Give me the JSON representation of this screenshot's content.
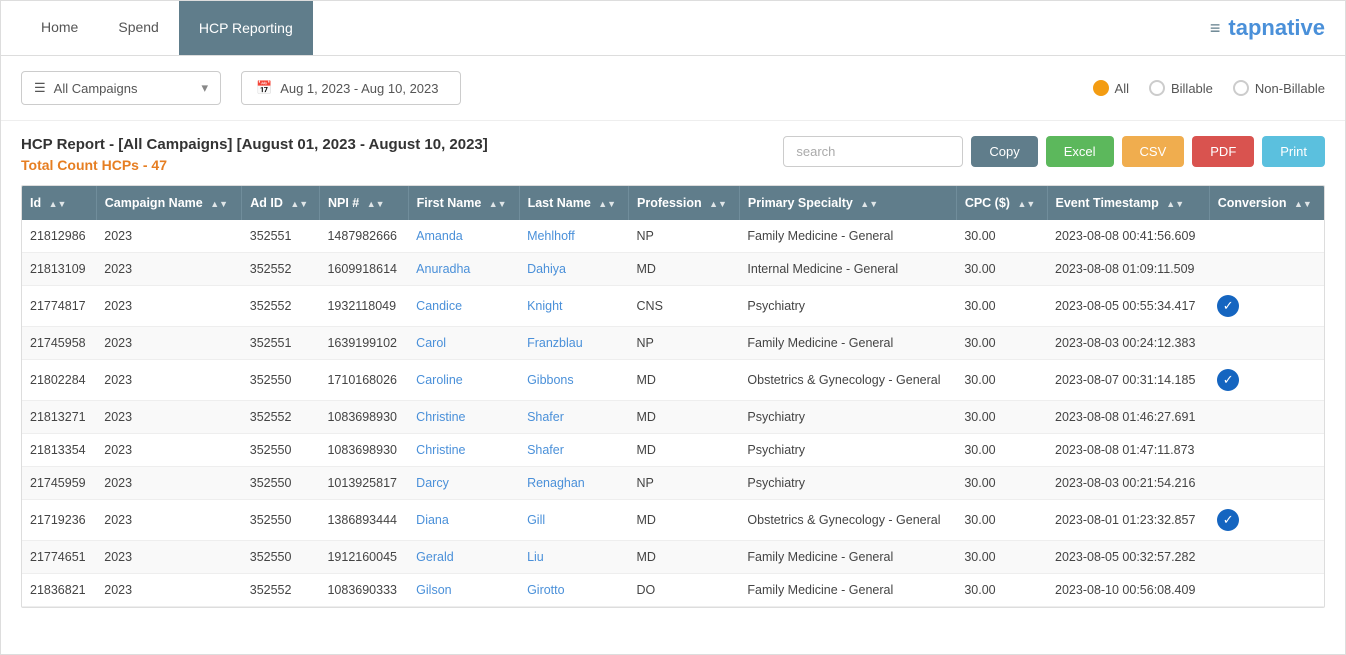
{
  "nav": {
    "tabs": [
      {
        "id": "home",
        "label": "Home",
        "active": false
      },
      {
        "id": "spend",
        "label": "Spend",
        "active": false
      },
      {
        "id": "hcp-reporting",
        "label": "HCP Reporting",
        "active": true
      }
    ],
    "logo": {
      "icon": "≡",
      "text_part1": "tap",
      "text_part2": "native"
    }
  },
  "filters": {
    "campaign_placeholder": "All Campaigns",
    "date_range": "Aug 1, 2023 - Aug 10, 2023",
    "radio_options": [
      {
        "id": "all",
        "label": "All",
        "checked": true
      },
      {
        "id": "billable",
        "label": "Billable",
        "checked": false
      },
      {
        "id": "non-billable",
        "label": "Non-Billable",
        "checked": false
      }
    ]
  },
  "report": {
    "title": "HCP Report - [All Campaigns] [August 01, 2023 - August 10, 2023]",
    "count_label": "Total Count HCPs -",
    "count_value": "47",
    "search_placeholder": "search"
  },
  "toolbar_buttons": {
    "copy": "Copy",
    "excel": "Excel",
    "csv": "CSV",
    "pdf": "PDF",
    "print": "Print"
  },
  "table": {
    "columns": [
      {
        "id": "id",
        "label": "Id",
        "sortable": true
      },
      {
        "id": "campaign_name",
        "label": "Campaign Name",
        "sortable": true
      },
      {
        "id": "ad_id",
        "label": "Ad ID",
        "sortable": true
      },
      {
        "id": "npi",
        "label": "NPI #",
        "sortable": true
      },
      {
        "id": "first_name",
        "label": "First Name",
        "sortable": true
      },
      {
        "id": "last_name",
        "label": "Last Name",
        "sortable": true
      },
      {
        "id": "profession",
        "label": "Profession",
        "sortable": true
      },
      {
        "id": "primary_specialty",
        "label": "Primary Specialty",
        "sortable": true
      },
      {
        "id": "cpc",
        "label": "CPC ($)",
        "sortable": true
      },
      {
        "id": "event_timestamp",
        "label": "Event Timestamp",
        "sortable": true
      },
      {
        "id": "conversion",
        "label": "Conversion",
        "sortable": true
      }
    ],
    "rows": [
      {
        "id": "21812986",
        "campaign_name": "2023",
        "ad_id": "352551",
        "npi": "1487982666",
        "first_name": "Amanda",
        "last_name": "Mehlhoff",
        "profession": "NP",
        "primary_specialty": "Family Medicine - General",
        "cpc": "30.00",
        "event_timestamp": "2023-08-08 00:41:56.609",
        "conversion": false
      },
      {
        "id": "21813109",
        "campaign_name": "2023",
        "ad_id": "352552",
        "npi": "1609918614",
        "first_name": "Anuradha",
        "last_name": "Dahiya",
        "profession": "MD",
        "primary_specialty": "Internal Medicine - General",
        "cpc": "30.00",
        "event_timestamp": "2023-08-08 01:09:11.509",
        "conversion": false
      },
      {
        "id": "21774817",
        "campaign_name": "2023",
        "ad_id": "352552",
        "npi": "1932118049",
        "first_name": "Candice",
        "last_name": "Knight",
        "profession": "CNS",
        "primary_specialty": "Psychiatry",
        "cpc": "30.00",
        "event_timestamp": "2023-08-05 00:55:34.417",
        "conversion": true
      },
      {
        "id": "21745958",
        "campaign_name": "2023",
        "ad_id": "352551",
        "npi": "1639199102",
        "first_name": "Carol",
        "last_name": "Franzblau",
        "profession": "NP",
        "primary_specialty": "Family Medicine - General",
        "cpc": "30.00",
        "event_timestamp": "2023-08-03 00:24:12.383",
        "conversion": false
      },
      {
        "id": "21802284",
        "campaign_name": "2023",
        "ad_id": "352550",
        "npi": "1710168026",
        "first_name": "Caroline",
        "last_name": "Gibbons",
        "profession": "MD",
        "primary_specialty": "Obstetrics & Gynecology - General",
        "cpc": "30.00",
        "event_timestamp": "2023-08-07 00:31:14.185",
        "conversion": true
      },
      {
        "id": "21813271",
        "campaign_name": "2023",
        "ad_id": "352552",
        "npi": "1083698930",
        "first_name": "Christine",
        "last_name": "Shafer",
        "profession": "MD",
        "primary_specialty": "Psychiatry",
        "cpc": "30.00",
        "event_timestamp": "2023-08-08 01:46:27.691",
        "conversion": false
      },
      {
        "id": "21813354",
        "campaign_name": "2023",
        "ad_id": "352550",
        "npi": "1083698930",
        "first_name": "Christine",
        "last_name": "Shafer",
        "profession": "MD",
        "primary_specialty": "Psychiatry",
        "cpc": "30.00",
        "event_timestamp": "2023-08-08 01:47:11.873",
        "conversion": false
      },
      {
        "id": "21745959",
        "campaign_name": "2023",
        "ad_id": "352550",
        "npi": "1013925817",
        "first_name": "Darcy",
        "last_name": "Renaghan",
        "profession": "NP",
        "primary_specialty": "Psychiatry",
        "cpc": "30.00",
        "event_timestamp": "2023-08-03 00:21:54.216",
        "conversion": false
      },
      {
        "id": "21719236",
        "campaign_name": "2023",
        "ad_id": "352550",
        "npi": "1386893444",
        "first_name": "Diana",
        "last_name": "Gill",
        "profession": "MD",
        "primary_specialty": "Obstetrics & Gynecology - General",
        "cpc": "30.00",
        "event_timestamp": "2023-08-01 01:23:32.857",
        "conversion": true
      },
      {
        "id": "21774651",
        "campaign_name": "2023",
        "ad_id": "352550",
        "npi": "1912160045",
        "first_name": "Gerald",
        "last_name": "Liu",
        "profession": "MD",
        "primary_specialty": "Family Medicine - General",
        "cpc": "30.00",
        "event_timestamp": "2023-08-05 00:32:57.282",
        "conversion": false
      },
      {
        "id": "21836821",
        "campaign_name": "2023",
        "ad_id": "352552",
        "npi": "1083690333",
        "first_name": "Gilson",
        "last_name": "Girotto",
        "profession": "DO",
        "primary_specialty": "Family Medicine - General",
        "cpc": "30.00",
        "event_timestamp": "2023-08-10 00:56:08.409",
        "conversion": false
      }
    ]
  }
}
